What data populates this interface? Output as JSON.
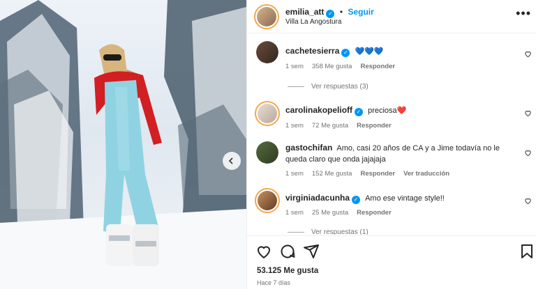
{
  "post": {
    "author": {
      "username": "emilia_att",
      "location": "Villa La Angostura"
    },
    "follow_label": "Seguir",
    "likes_text": "53.125 Me gusta",
    "time_text": "Hace 7 días"
  },
  "comments": [
    {
      "username": "cachetesierra",
      "text": "💙💙💙",
      "age": "1 sem",
      "likes": "358 Me gusta",
      "reply": "Responder",
      "view_replies": "Ver respuestas (3)"
    },
    {
      "username": "carolinakopelioff",
      "text": "preciosa❤️",
      "age": "1 sem",
      "likes": "72 Me gusta",
      "reply": "Responder"
    },
    {
      "username": "gastochifan",
      "text": "Amo, casi 20 años de CA y a Jime todavía no le queda claro que onda jajajaja",
      "age": "1 sem",
      "likes": "152 Me gusta",
      "reply": "Responder",
      "translation": "Ver traducción"
    },
    {
      "username": "virginiadacunha",
      "text": "Amo ese vintage style!!",
      "age": "1 sem",
      "likes": "25 Me gusta",
      "reply": "Responder",
      "view_replies": "Ver respuestas (1)"
    }
  ],
  "icons": [
    "more-options-icon",
    "heart-icon",
    "comment-icon",
    "share-icon",
    "bookmark-icon",
    "verified-icon",
    "carousel-arrow-icon"
  ],
  "colors": {
    "link": "#0095f6",
    "verified": "#0095f6",
    "secondary_text": "#737373",
    "story_ring": "#f4a64d"
  }
}
